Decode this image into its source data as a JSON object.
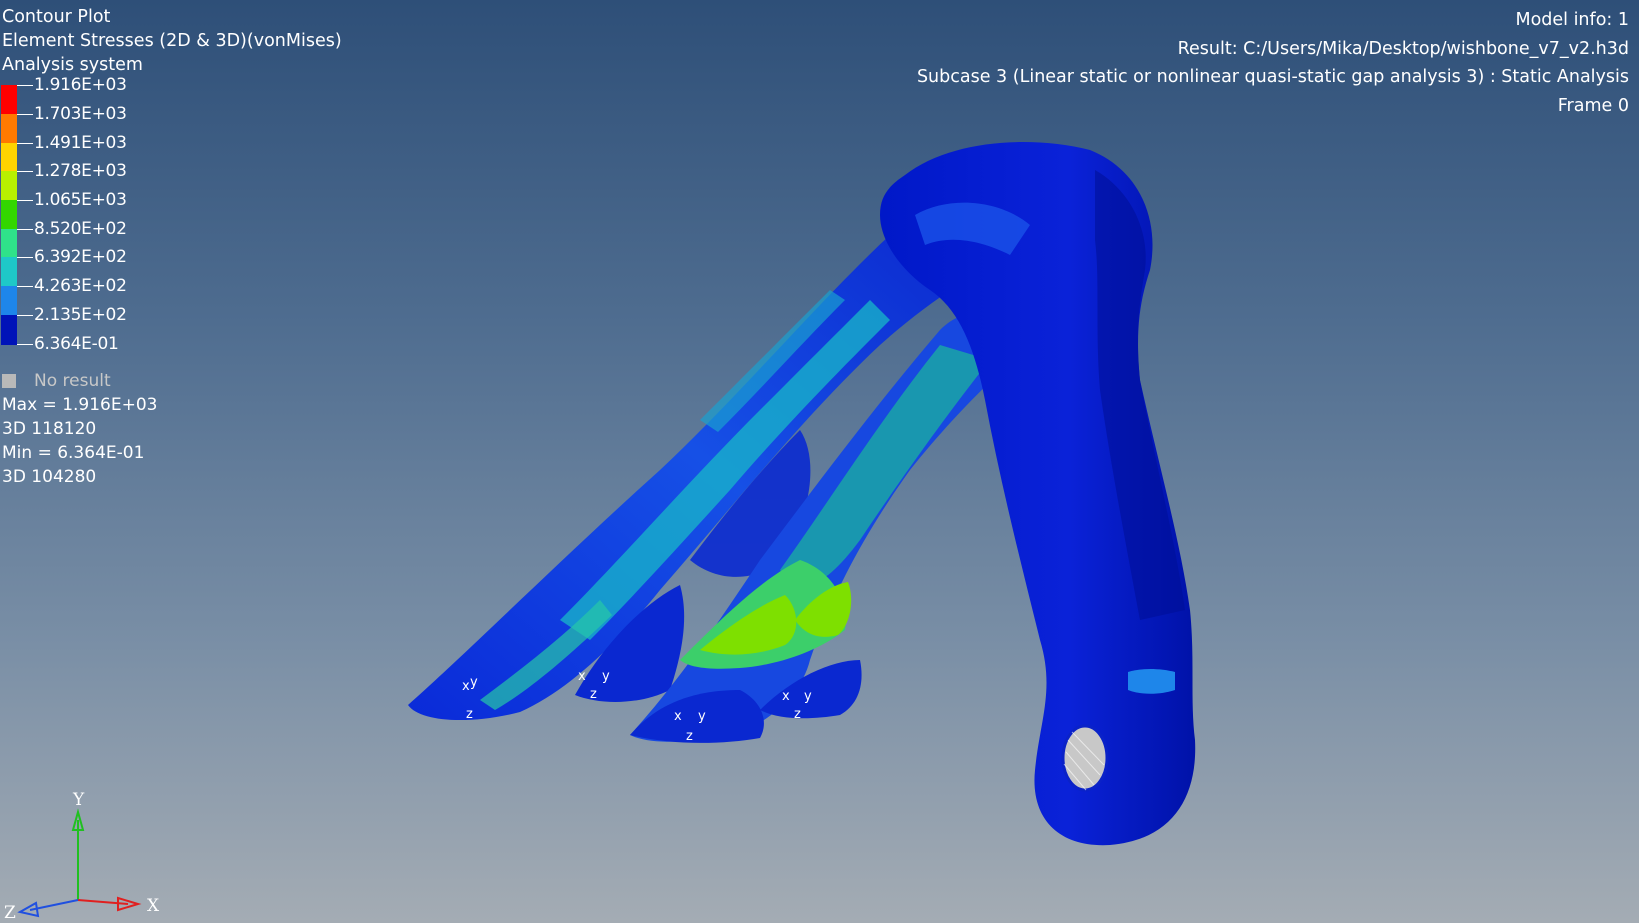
{
  "title": {
    "line1": "Contour Plot",
    "line2": "Element Stresses (2D & 3D)(vonMises)",
    "line3": "Analysis system"
  },
  "legend": {
    "levels": [
      {
        "label": "1.916E+03",
        "color": "#ff0000"
      },
      {
        "label": "1.703E+03",
        "color": "#ff7a00"
      },
      {
        "label": "1.491E+03",
        "color": "#ffd400"
      },
      {
        "label": "1.278E+03",
        "color": "#b8f000"
      },
      {
        "label": "1.065E+03",
        "color": "#33d600"
      },
      {
        "label": "8.520E+02",
        "color": "#2fe28a"
      },
      {
        "label": "6.392E+02",
        "color": "#1ec8c8"
      },
      {
        "label": "4.263E+02",
        "color": "#1e86ea"
      },
      {
        "label": "2.135E+02",
        "color": "#0013b8"
      },
      {
        "label": "6.364E-01",
        "color": null
      }
    ],
    "no_result": "No result"
  },
  "stats": {
    "max": "Max = 1.916E+03",
    "max_elem": "3D 118120",
    "min": "Min = 6.364E-01",
    "min_elem": "3D 104280"
  },
  "info": {
    "model": "Model info: 1",
    "result": "Result: C:/Users/Mika/Desktop/wishbone_v7_v2.h3d",
    "subcase": "Subcase 3 (Linear static or nonlinear quasi-static gap analysis 3) : Static Analysis",
    "frame": "Frame 0"
  },
  "triad": {
    "x": "X",
    "y": "Y",
    "z": "Z",
    "x_color": "#e02020",
    "y_color": "#20c020",
    "z_color": "#2050e0"
  },
  "model_icons": {
    "mesh_object": "wishbone-part-icon",
    "constraint_marker": "local-axis-icon",
    "constraint_labels": [
      "x",
      "y",
      "z"
    ]
  }
}
